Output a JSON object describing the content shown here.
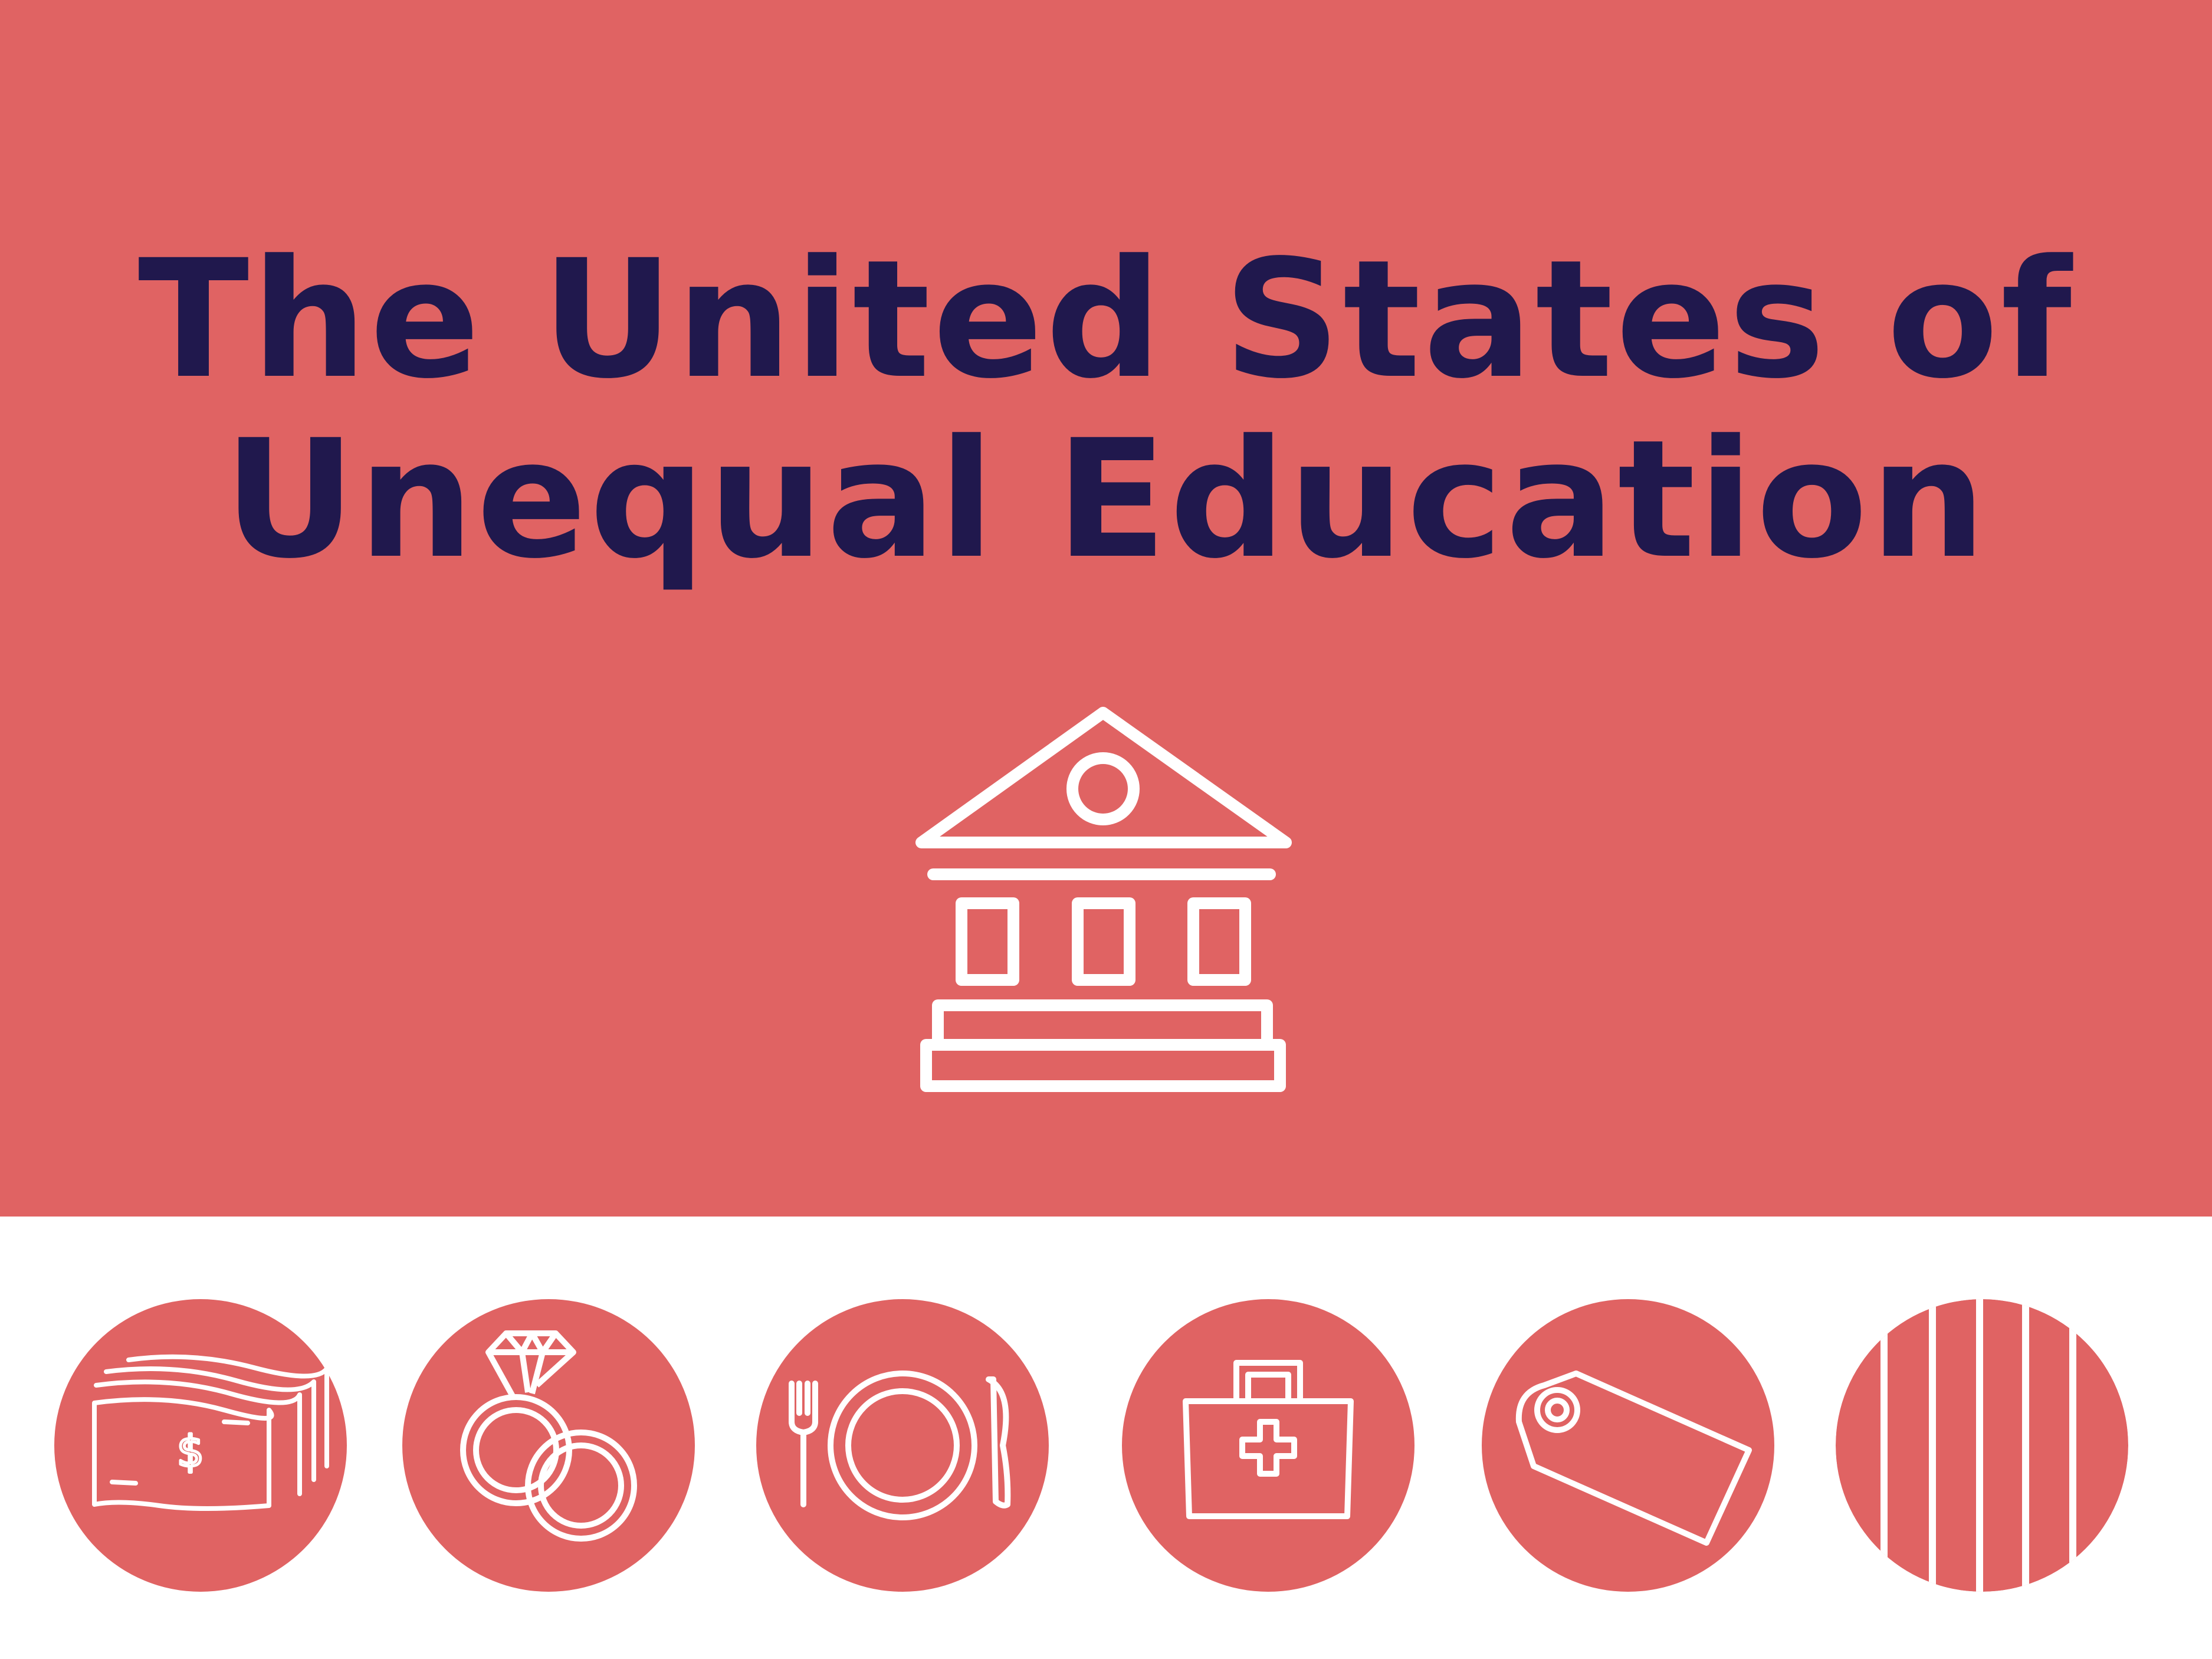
{
  "title": {
    "line1": "The United States of",
    "line2": "Unequal Education"
  },
  "colors": {
    "background": "#e06363",
    "title": "#20184d",
    "icon_stroke": "#ffffff",
    "footer": "#ffffff"
  },
  "hero_icon": "school-building-icon",
  "topic_icons": [
    "money-icon",
    "wedding-rings-icon",
    "plate-fork-knife-icon",
    "first-aid-kit-icon",
    "price-tag-icon",
    "prison-bars-icon"
  ]
}
